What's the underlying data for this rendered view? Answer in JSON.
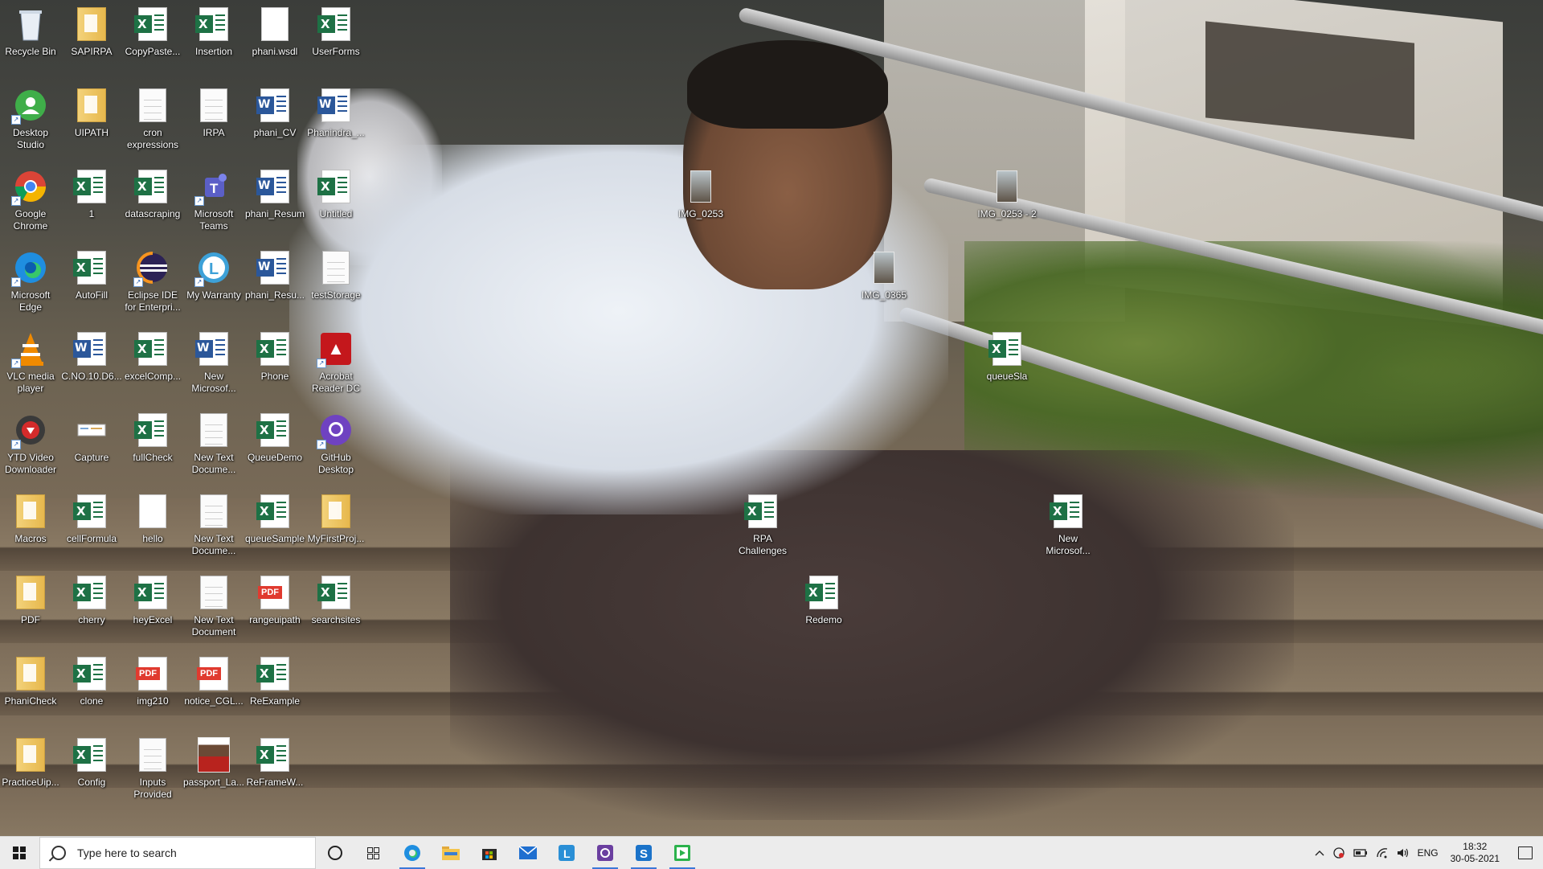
{
  "desktop": {
    "icons": [
      {
        "label": "Recycle Bin",
        "type": "recycle"
      },
      {
        "label": "SAPIRPA",
        "type": "folder"
      },
      {
        "label": "CopyPaste...",
        "type": "excel"
      },
      {
        "label": "Insertion",
        "type": "excel"
      },
      {
        "label": "phani.wsdl",
        "type": "blank"
      },
      {
        "label": "UserForms",
        "type": "excel"
      },
      {
        "label": "Desktop Studio",
        "type": "studio"
      },
      {
        "label": "UIPATH",
        "type": "folder"
      },
      {
        "label": "cron expressions",
        "type": "doc"
      },
      {
        "label": "IRPA",
        "type": "doc"
      },
      {
        "label": "phani_CV",
        "type": "word"
      },
      {
        "label": "Phanindra_...",
        "type": "word"
      },
      {
        "label": "Google Chrome",
        "type": "chrome"
      },
      {
        "label": "1",
        "type": "excel"
      },
      {
        "label": "datascraping",
        "type": "excel"
      },
      {
        "label": "Microsoft Teams",
        "type": "teams"
      },
      {
        "label": "phani_Resum",
        "type": "word"
      },
      {
        "label": "Untitled",
        "type": "excel"
      },
      {
        "label": "Microsoft Edge",
        "type": "edge"
      },
      {
        "label": "AutoFill",
        "type": "excel"
      },
      {
        "label": "Eclipse IDE for Enterpri...",
        "type": "eclipse"
      },
      {
        "label": "My Warranty",
        "type": "warranty"
      },
      {
        "label": "phani_Resu...",
        "type": "word"
      },
      {
        "label": "testStorage",
        "type": "doc"
      },
      {
        "label": "VLC media player",
        "type": "vlc"
      },
      {
        "label": "C.NO.10.D6...",
        "type": "word"
      },
      {
        "label": "excelComp...",
        "type": "excel"
      },
      {
        "label": "New Microsof...",
        "type": "word"
      },
      {
        "label": "Phone",
        "type": "excel"
      },
      {
        "label": "Acrobat Reader DC",
        "type": "acrobat"
      },
      {
        "label": "YTD Video Downloader",
        "type": "ytd"
      },
      {
        "label": "Capture",
        "type": "capture"
      },
      {
        "label": "fullCheck",
        "type": "excel"
      },
      {
        "label": "New Text Docume...",
        "type": "doc"
      },
      {
        "label": "QueueDemo",
        "type": "excel"
      },
      {
        "label": "GitHub Desktop",
        "type": "github"
      },
      {
        "label": "Macros",
        "type": "folder"
      },
      {
        "label": "cellFormula",
        "type": "excel"
      },
      {
        "label": "hello",
        "type": "blank"
      },
      {
        "label": "New Text Docume...",
        "type": "doc"
      },
      {
        "label": "queueSample",
        "type": "excel"
      },
      {
        "label": "MyFirstProj...",
        "type": "folder"
      },
      {
        "label": "PDF",
        "type": "folder"
      },
      {
        "label": "cherry",
        "type": "excel"
      },
      {
        "label": "heyExcel",
        "type": "excel"
      },
      {
        "label": "New Text Document",
        "type": "doc"
      },
      {
        "label": "rangeuipath",
        "type": "pdf"
      },
      {
        "label": "searchsites",
        "type": "excel"
      },
      {
        "label": "PhaniCheck",
        "type": "folder"
      },
      {
        "label": "clone",
        "type": "excel"
      },
      {
        "label": "img210",
        "type": "pdf"
      },
      {
        "label": "notice_CGL...",
        "type": "pdf"
      },
      {
        "label": "ReExample",
        "type": "excel"
      },
      {
        "label": "PracticeUip...",
        "type": "folder"
      },
      {
        "label": "Config",
        "type": "excel"
      },
      {
        "label": "Inputs Provided",
        "type": "doc"
      },
      {
        "label": "passport_La...",
        "type": "portrait"
      },
      {
        "label": "ReFrameW...",
        "type": "excel"
      },
      {
        "label": "IMG_0253",
        "type": "photo"
      },
      {
        "label": "IMG_0253 - 2",
        "type": "photo"
      },
      {
        "label": "IMG_0365",
        "type": "photo"
      },
      {
        "label": "queueSla",
        "type": "excel"
      },
      {
        "label": "RPA Challenges",
        "type": "excel"
      },
      {
        "label": "New Microsof...",
        "type": "excel"
      },
      {
        "label": "Redemo",
        "type": "excel"
      }
    ]
  },
  "taskbar": {
    "search_placeholder": "Type here to search",
    "apps": [
      "edge",
      "file-explorer",
      "store",
      "mail",
      "app-l",
      "app-purple",
      "app-s",
      "app-green"
    ],
    "tray": {
      "language": "ENG",
      "time": "18:32",
      "date": "30-05-2021"
    }
  },
  "colors": {
    "excel": "#1e7145",
    "word": "#2b579a",
    "pdf": "#e03a2f",
    "taskbar": "#ececec",
    "accent": "#3b78d8"
  }
}
